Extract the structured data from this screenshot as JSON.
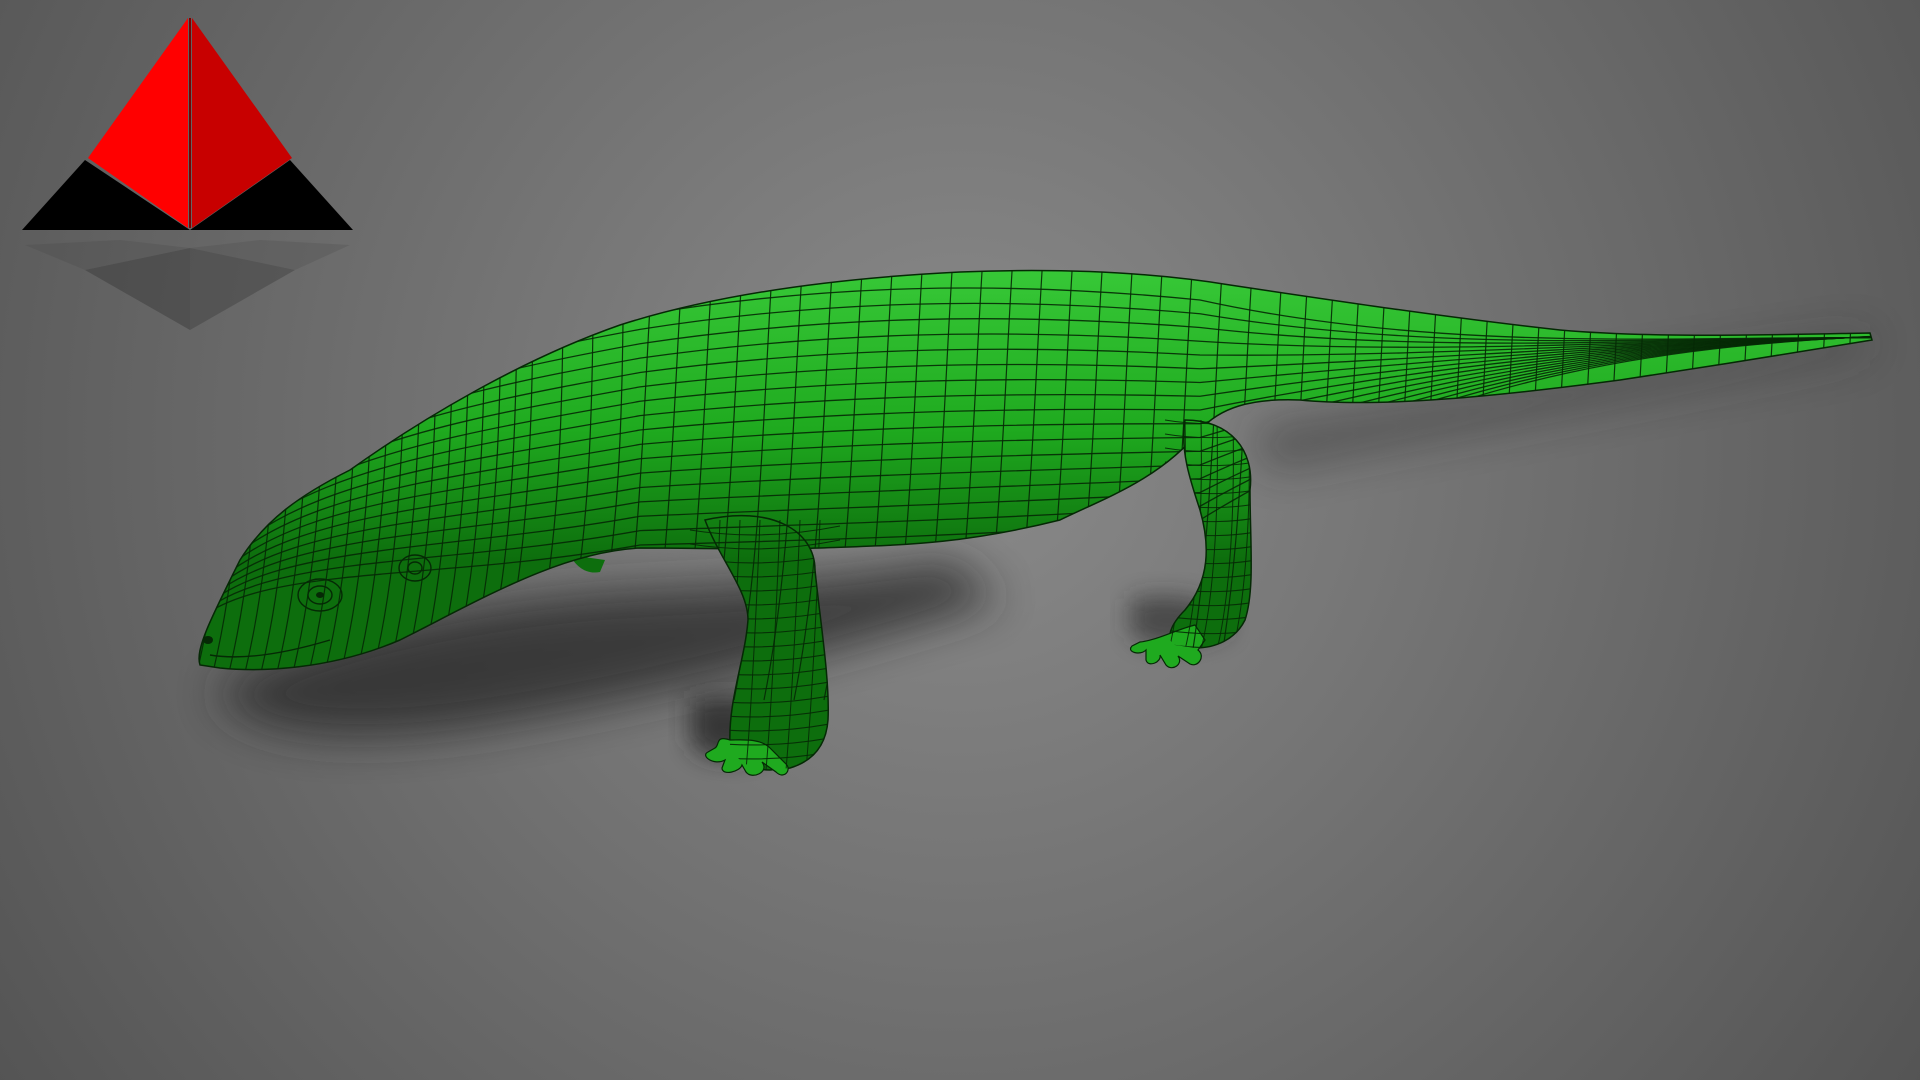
{
  "scene": {
    "background": {
      "center_color": "#8a8a8a",
      "edge_color": "#505050"
    },
    "logo": {
      "icon": "pyramid-logo-icon",
      "colors": {
        "face": "#ff0000",
        "face_dark": "#c80000",
        "base": "#000000",
        "reflection": "#3f3f3f"
      }
    },
    "model": {
      "icon": "lizard-wireframe-icon",
      "colors": {
        "skin": "#1faa1f",
        "skin_shadow": "#0d6e0d",
        "skin_highlight": "#37c837",
        "wire": "#052905",
        "ground_shadow": "#262626"
      }
    }
  }
}
